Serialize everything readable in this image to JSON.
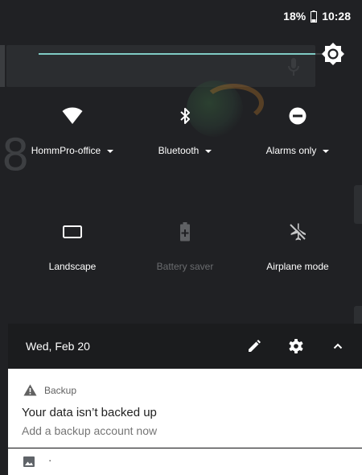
{
  "status_bar": {
    "battery_percent": "18%",
    "time": "10:28",
    "battery_icon": "battery-low-icon"
  },
  "brightness": {
    "level": 0.94,
    "icon": "brightness-icon"
  },
  "tiles": [
    {
      "label": "HommPro-office",
      "icon": "wifi-icon",
      "has_dropdown": true,
      "enabled": true
    },
    {
      "label": "Bluetooth",
      "icon": "bluetooth-icon",
      "has_dropdown": true,
      "enabled": true
    },
    {
      "label": "Alarms only",
      "icon": "do-not-disturb-icon",
      "has_dropdown": true,
      "enabled": true
    },
    {
      "label": "Landscape",
      "icon": "screen-rotation-icon",
      "has_dropdown": false,
      "enabled": true
    },
    {
      "label": "Battery saver",
      "icon": "battery-saver-icon",
      "has_dropdown": false,
      "enabled": false
    },
    {
      "label": "Airplane mode",
      "icon": "airplane-icon",
      "has_dropdown": false,
      "enabled": true
    }
  ],
  "date_bar": {
    "date": "Wed, Feb 20",
    "edit_icon": "pencil-icon",
    "settings_icon": "gear-icon",
    "collapse_icon": "chevron-up-icon"
  },
  "notifications": [
    {
      "app": "Backup",
      "app_icon": "warning-icon",
      "title": "Your data isn’t backed up",
      "body": "Add a backup account now"
    },
    {
      "app_icon": "image-icon",
      "text": "·"
    }
  ],
  "colors": {
    "shade_background": "#202124",
    "accent": "#80cbc4",
    "notification_background": "#ffffff"
  }
}
